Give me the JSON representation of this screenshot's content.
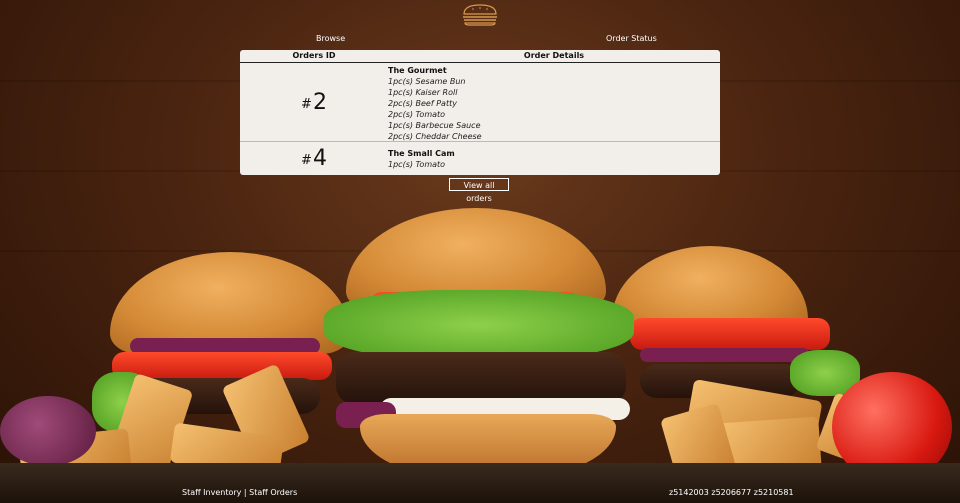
{
  "app": {
    "logo_icon": "burger-icon"
  },
  "nav": {
    "browse_label": "Browse",
    "status_label": "Order Status"
  },
  "table": {
    "headers": {
      "id": "Orders ID",
      "details": "Order Details"
    },
    "orders": [
      {
        "hash": "#",
        "number": "2",
        "name": "The Gourmet",
        "items": [
          "1pc(s) Sesame Bun",
          "1pc(s) Kaiser Roll",
          "2pc(s) Beef Patty",
          "2pc(s) Tomato",
          "1pc(s) Barbecue Sauce",
          "2pc(s) Cheddar Cheese"
        ]
      },
      {
        "hash": "#",
        "number": "4",
        "name": "The Small Cam",
        "items": [
          "1pc(s) Tomato"
        ]
      }
    ]
  },
  "actions": {
    "view_all_label": "View all orders"
  },
  "footer": {
    "links_text": "Staff Inventory | Staff Orders",
    "credits_text": "z5142003 z5206677 z5210581"
  },
  "colors": {
    "panel_bg": "#f2eeea",
    "text_light": "#ffffff",
    "background_brown": "#4a2410"
  }
}
